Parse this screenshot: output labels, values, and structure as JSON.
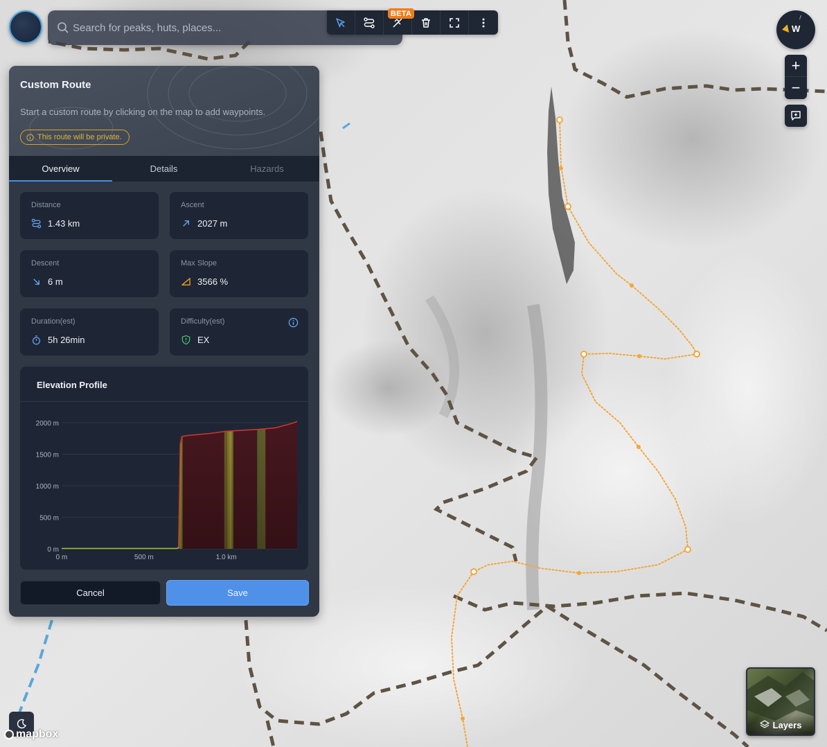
{
  "search": {
    "placeholder": "Search for peaks, huts, places..."
  },
  "toolbar": {
    "tools": [
      "select-cursor-icon",
      "route-icon",
      "route-beta-icon",
      "trash-icon",
      "fullscreen-icon",
      "more-vertical-icon"
    ],
    "beta_label": "BETA"
  },
  "compass": {
    "label": "W"
  },
  "zoom": {
    "in_label": "+",
    "out_label": "−"
  },
  "layers": {
    "label": "Layers"
  },
  "attribution": {
    "label": "mapbox"
  },
  "panel": {
    "title": "Custom Route",
    "subtitle": "Start a custom route by clicking on the map to add waypoints.",
    "private_notice": "This route will be private.",
    "tabs": [
      {
        "label": "Overview",
        "state": "active"
      },
      {
        "label": "Details",
        "state": "normal"
      },
      {
        "label": "Hazards",
        "state": "disabled"
      }
    ],
    "stats": {
      "distance": {
        "label": "Distance",
        "value": "1.43 km",
        "icon": "route-icon"
      },
      "ascent": {
        "label": "Ascent",
        "value": "2027 m",
        "icon": "arrow-up-right-icon"
      },
      "descent": {
        "label": "Descent",
        "value": "6 m",
        "icon": "arrow-down-right-icon"
      },
      "max_slope": {
        "label": "Max Slope",
        "value": "3566 %",
        "icon": "slope-icon"
      },
      "duration": {
        "label": "Duration(est)",
        "value": "5h 26min",
        "icon": "stopwatch-icon"
      },
      "difficulty": {
        "label": "Difficulty(est)",
        "value": "EX",
        "icon": "shield-icon"
      }
    },
    "elevation": {
      "title": "Elevation Profile"
    },
    "cancel_label": "Cancel",
    "save_label": "Save"
  },
  "colors": {
    "accent": "#4f90e8",
    "route": "#f4a63a",
    "panel_bg": "#303846",
    "card_bg": "#1e2636",
    "warning": "#e3b334",
    "beta": "#f07d1a"
  },
  "chart_data": {
    "type": "area",
    "title": "Elevation Profile",
    "xlabel": "",
    "ylabel": "",
    "x_tick_labels": [
      "0 m",
      "500 m",
      "1.0 km"
    ],
    "y_tick_labels": [
      "0 m",
      "500 m",
      "1000 m",
      "1500 m",
      "2000 m"
    ],
    "x_ticks": [
      0,
      500,
      1000
    ],
    "y_ticks": [
      0,
      500,
      1000,
      1500,
      2000
    ],
    "xlim": [
      0,
      1430
    ],
    "ylim": [
      0,
      2000
    ],
    "grid": true,
    "series": [
      {
        "x": [
          0,
          200,
          400,
          700,
          710,
          715,
          720,
          730,
          760,
          800,
          900,
          1000,
          1100,
          1200,
          1300,
          1350,
          1400,
          1430
        ],
        "values": [
          5,
          5,
          5,
          5,
          20,
          800,
          1650,
          1780,
          1795,
          1805,
          1830,
          1865,
          1880,
          1895,
          1920,
          1955,
          1990,
          2020
        ]
      }
    ]
  }
}
